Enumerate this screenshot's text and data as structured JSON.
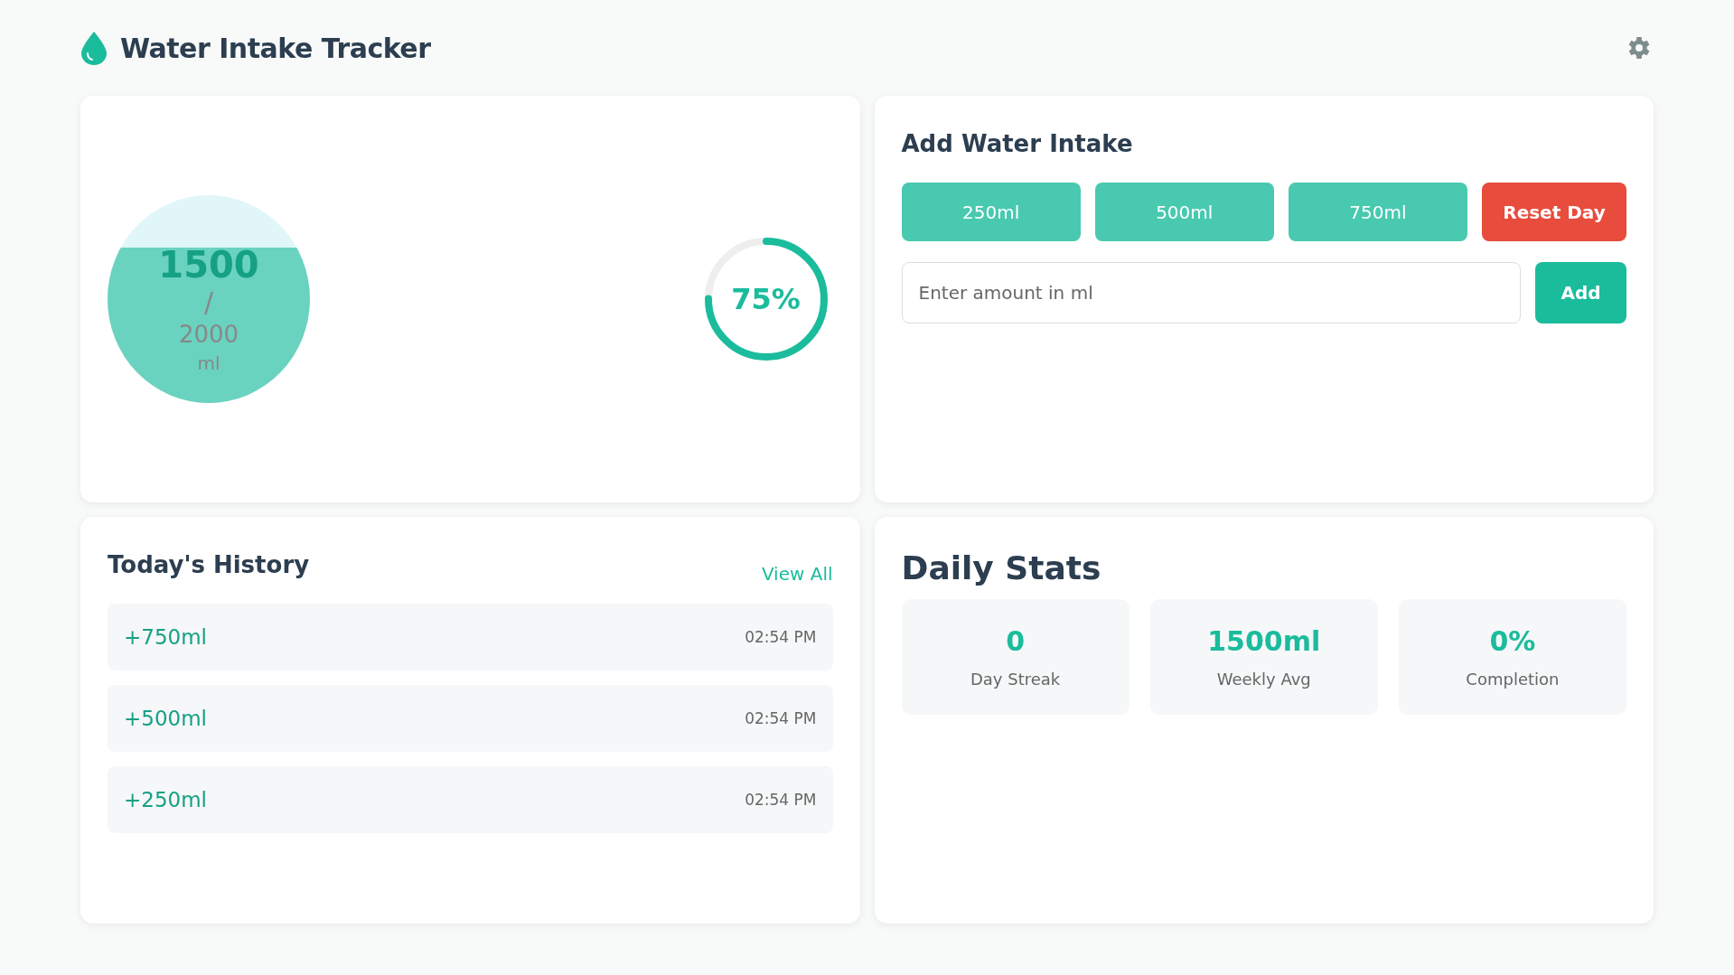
{
  "header": {
    "title": "Water Intake Tracker"
  },
  "progress": {
    "consumed": "1500",
    "separator": "/",
    "goal": "2000",
    "unit": "ml",
    "level": 0.75,
    "percent": "75%",
    "ring": {
      "level": 0.75
    }
  },
  "add_intake": {
    "title": "Add Water Intake",
    "quick_buttons": [
      {
        "label": "250ml",
        "kind": "quick"
      },
      {
        "label": "500ml",
        "kind": "quick"
      },
      {
        "label": "750ml",
        "kind": "quick"
      },
      {
        "label": "Reset Day",
        "kind": "reset"
      }
    ],
    "amount_field": {
      "placeholder": "Enter amount in ml"
    },
    "add_button": "Add"
  },
  "history": {
    "title": "Today's History",
    "view_all": "View All",
    "items": [
      {
        "amount": "+750ml",
        "time": "02:54 PM"
      },
      {
        "amount": "+500ml",
        "time": "02:54 PM"
      },
      {
        "amount": "+250ml",
        "time": "02:54 PM"
      }
    ]
  },
  "daily_stats": {
    "title": "Daily Stats",
    "stats": [
      {
        "value": "0",
        "label": "Day Streak"
      },
      {
        "value": "1500ml",
        "label": "Weekly Avg"
      },
      {
        "value": "0%",
        "label": "Completion"
      }
    ]
  }
}
